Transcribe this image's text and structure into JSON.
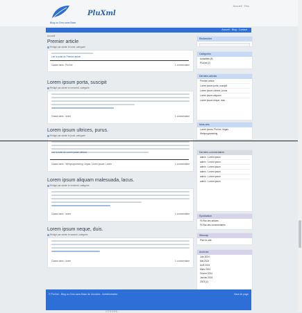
{
  "header": {
    "tagline": "Blog ou Cms sans Base",
    "brand": "PluXml",
    "top_links": "Accueil · Rss"
  },
  "nav": {
    "links": "Accueil · Blog · Contact"
  },
  "breadcrumb": "Accueil",
  "posts": [
    {
      "title": "Premier article",
      "meta": "Rédigé par admin le lundi, catégorie",
      "read": "Lire la suite de Premier article",
      "tags": "Classé dans : PluXml",
      "comments": "1 commentaire"
    },
    {
      "title": "Lorem ipsum porta, suscipit",
      "meta": "Rédigé par admin le mercredi, catégorie",
      "read": "Lire la suite de Lorem ipsum porta",
      "tags": "Classé dans : lorem",
      "comments": "1 commentaire"
    },
    {
      "title": "Lorem ipsum ultrices, purus.",
      "meta": "Rédigé par admin le jeudi, catégorie",
      "read": "Lire la suite de Lorem ipsum ultrices",
      "tags": "Classé dans : Webprogramming, Vegas, Lorem ipsum, Lorem",
      "comments": "1 commentaire"
    },
    {
      "title": "Lorem ipsum aliquam malesuada, lacus.",
      "meta": "Rédigé par admin le vendredi, catégorie",
      "read": "Lire la suite de Lorem ipsum aliquam",
      "tags": "Classé dans : lorem",
      "comments": "1 commentaire"
    },
    {
      "title": "Lorem ipsum neque, duis.",
      "meta": "Rédigé par admin le samedi, catégorie",
      "read": "Lire la suite de Lorem ipsum neque",
      "tags": "Classé dans : lorem",
      "comments": "1 commentaire"
    }
  ],
  "pager": "1 2 3 4 5 6",
  "sidebar": {
    "search_title": "Rechercher",
    "categories_title": "Catégories",
    "categories": [
      "Actualités (5)",
      "PluXml (2)"
    ],
    "recent_title": "Derniers articles",
    "recent": [
      "Premier article",
      "Lorem ipsum porta, suscipit",
      "Lorem ipsum ultrices, purus.",
      "Lorem ipsum aliquam",
      "Lorem ipsum neque, duis."
    ],
    "tags_title": "Mots clés",
    "tags": [
      "Lorem ipsum, PluXml, Vegas",
      "Webprogramming"
    ],
    "comments_title": "Derniers commentaires",
    "comments": [
      "admin : Lorem ipsum",
      "admin : Lorem ipsum",
      "admin : Lorem ipsum",
      "admin : Lorem ipsum",
      "admin : Lorem ipsum",
      "admin : Lorem ipsum"
    ],
    "syndication_title": "Syndication",
    "syndication": [
      "Fil Rss des articles",
      "Fil Rss des commentaires"
    ],
    "sitemap_title": "Sitemap",
    "sitemap": [
      "Plan du site"
    ],
    "archives_title": "Archives",
    "archives": [
      "Juin 2024",
      "Mai 2024",
      "Avril 2024",
      "Mars 2024",
      "Février 2024",
      "Janvier 2024",
      "2023 (2)"
    ]
  },
  "footer": {
    "left": "© PluXml - Blog ou Cms sans Base de données - Administration",
    "right": "Haut de page"
  }
}
